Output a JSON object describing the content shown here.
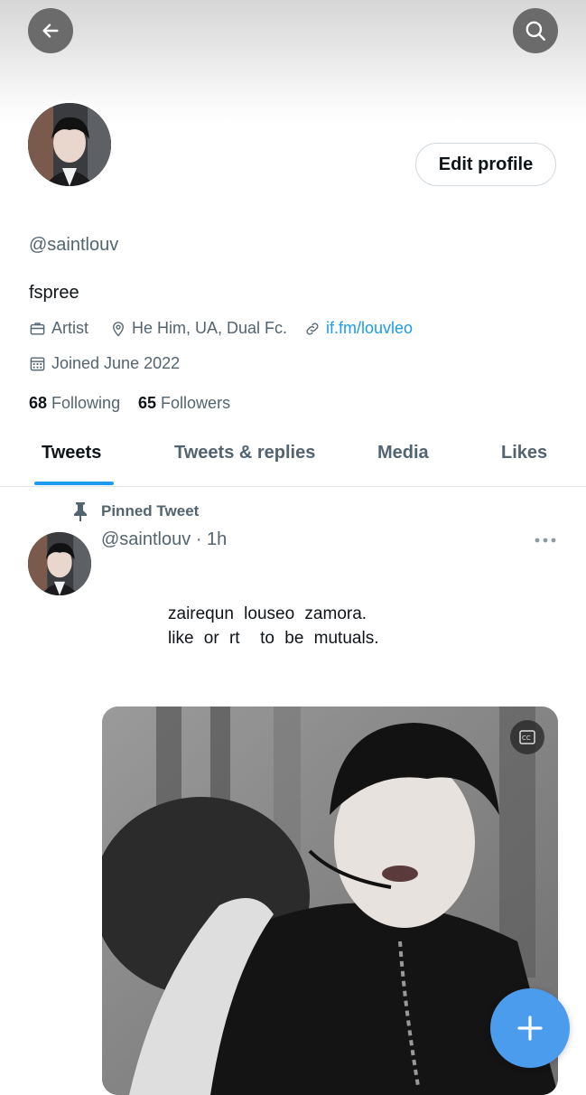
{
  "header": {
    "back_icon": "arrow-left-icon",
    "search_icon": "search-icon",
    "edit_profile_label": "Edit profile"
  },
  "profile": {
    "handle": "@saintlouv",
    "bio": "fspree",
    "category": "Artist",
    "location": "He Him, UA, Dual Fc.",
    "link": "if.fm/louvleo",
    "joined": "Joined June 2022",
    "following_count": "68",
    "following_label": "Following",
    "followers_count": "65",
    "followers_label": "Followers"
  },
  "tabs": [
    {
      "label": "Tweets",
      "active": true
    },
    {
      "label": "Tweets & replies",
      "active": false
    },
    {
      "label": "Media",
      "active": false
    },
    {
      "label": "Likes",
      "active": false
    }
  ],
  "tweet": {
    "pinned_label": "Pinned Tweet",
    "handle": "@saintlouv",
    "separator": "·",
    "time": "1h",
    "text_line1": "zairequn louseo zamora.",
    "text_line2": "like or rt  to be mutuals."
  },
  "colors": {
    "accent": "#1d9bf0",
    "fab": "#4b9ced",
    "secondary_text": "#536471"
  }
}
